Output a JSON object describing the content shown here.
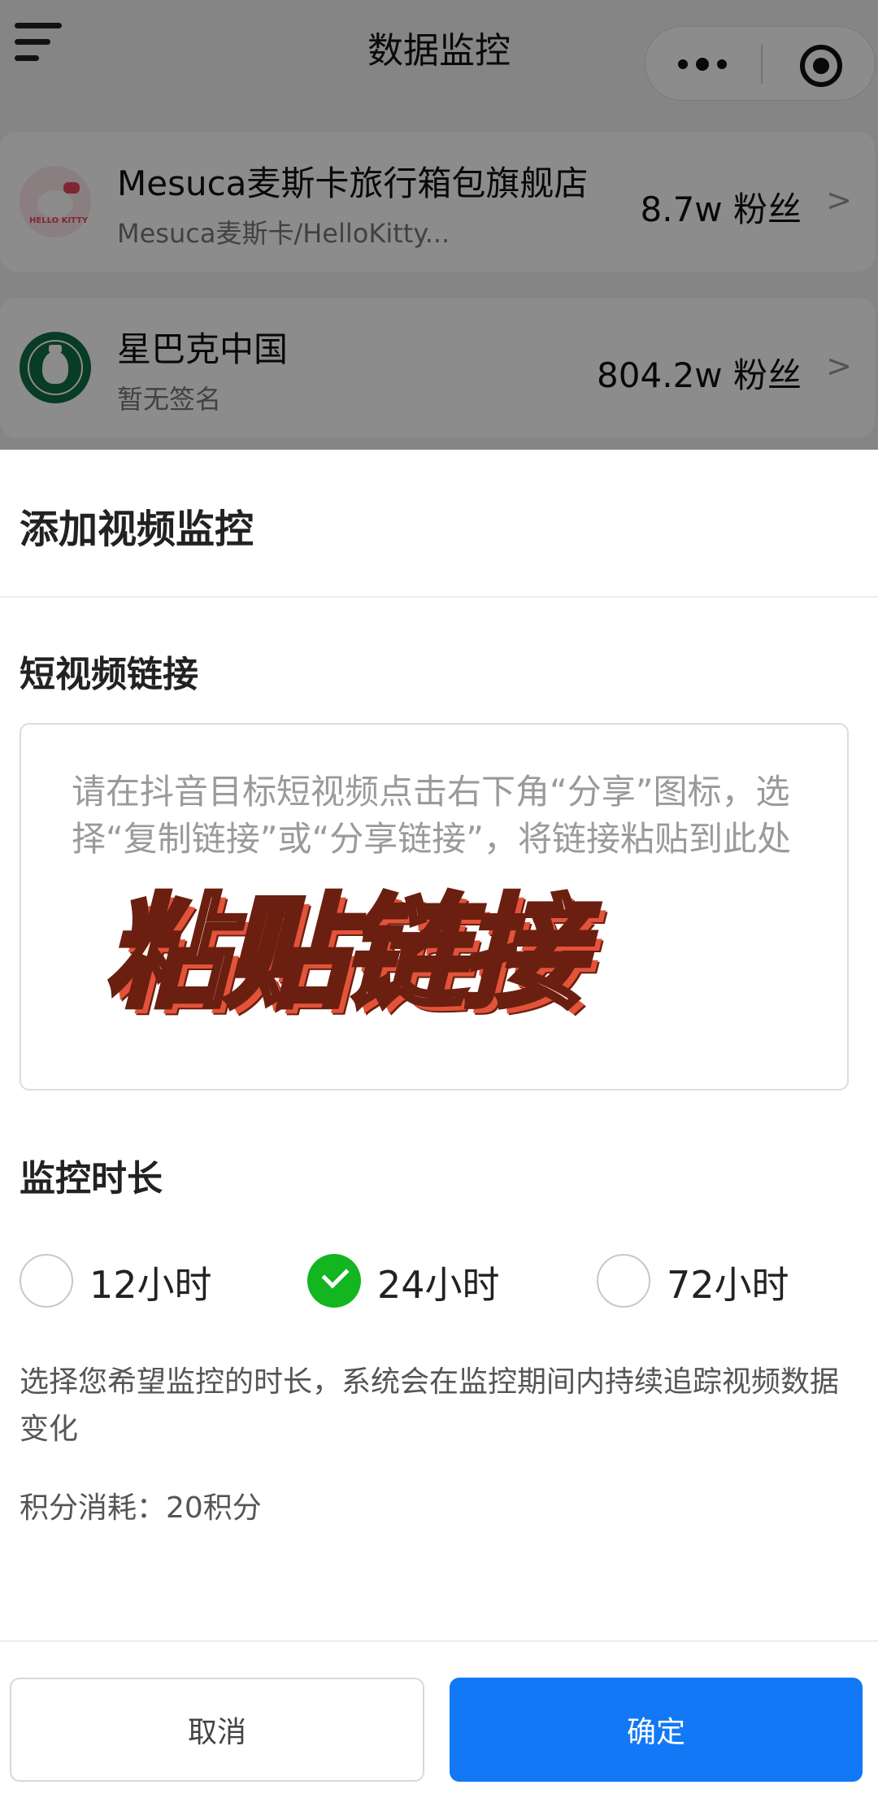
{
  "nav": {
    "title": "数据监控"
  },
  "shops": [
    {
      "name": "Mesuca麦斯卡旅行箱包旗舰店",
      "subtitle": "Mesuca麦斯卡/HelloKitty...",
      "fans": "8.7w 粉丝",
      "arrow": ">",
      "avatar_text": "HELLO KITTY"
    },
    {
      "name": "星巴克中国",
      "subtitle": "暂无签名",
      "fans": "804.2w 粉丝",
      "arrow": ">"
    }
  ],
  "sheet": {
    "title": "添加视频监控",
    "link_label": "短视频链接",
    "link_placeholder": "请在抖音目标短视频点击右下角“分享”图标，选择“复制链接”或“分享链接”，将链接粘贴到此处",
    "overlay_caption": "粘贴链接",
    "duration_label": "监控时长",
    "durations": [
      {
        "label": "12小时",
        "checked": false
      },
      {
        "label": "24小时",
        "checked": true
      },
      {
        "label": "72小时",
        "checked": false
      }
    ],
    "hint": "选择您希望监控的时长，系统会在监控期间内持续追踪视频数据变化",
    "cost": "积分消耗：20积分",
    "cancel_label": "取消",
    "confirm_label": "确定"
  },
  "colors": {
    "accent": "#1278f5",
    "check_green": "#13b521",
    "overlay_fill": "#fff6e4",
    "overlay_shadow": "#e2533a"
  },
  "icons": [
    "menu-icon",
    "more-dots-icon",
    "capsule-close-icon",
    "check-icon"
  ]
}
